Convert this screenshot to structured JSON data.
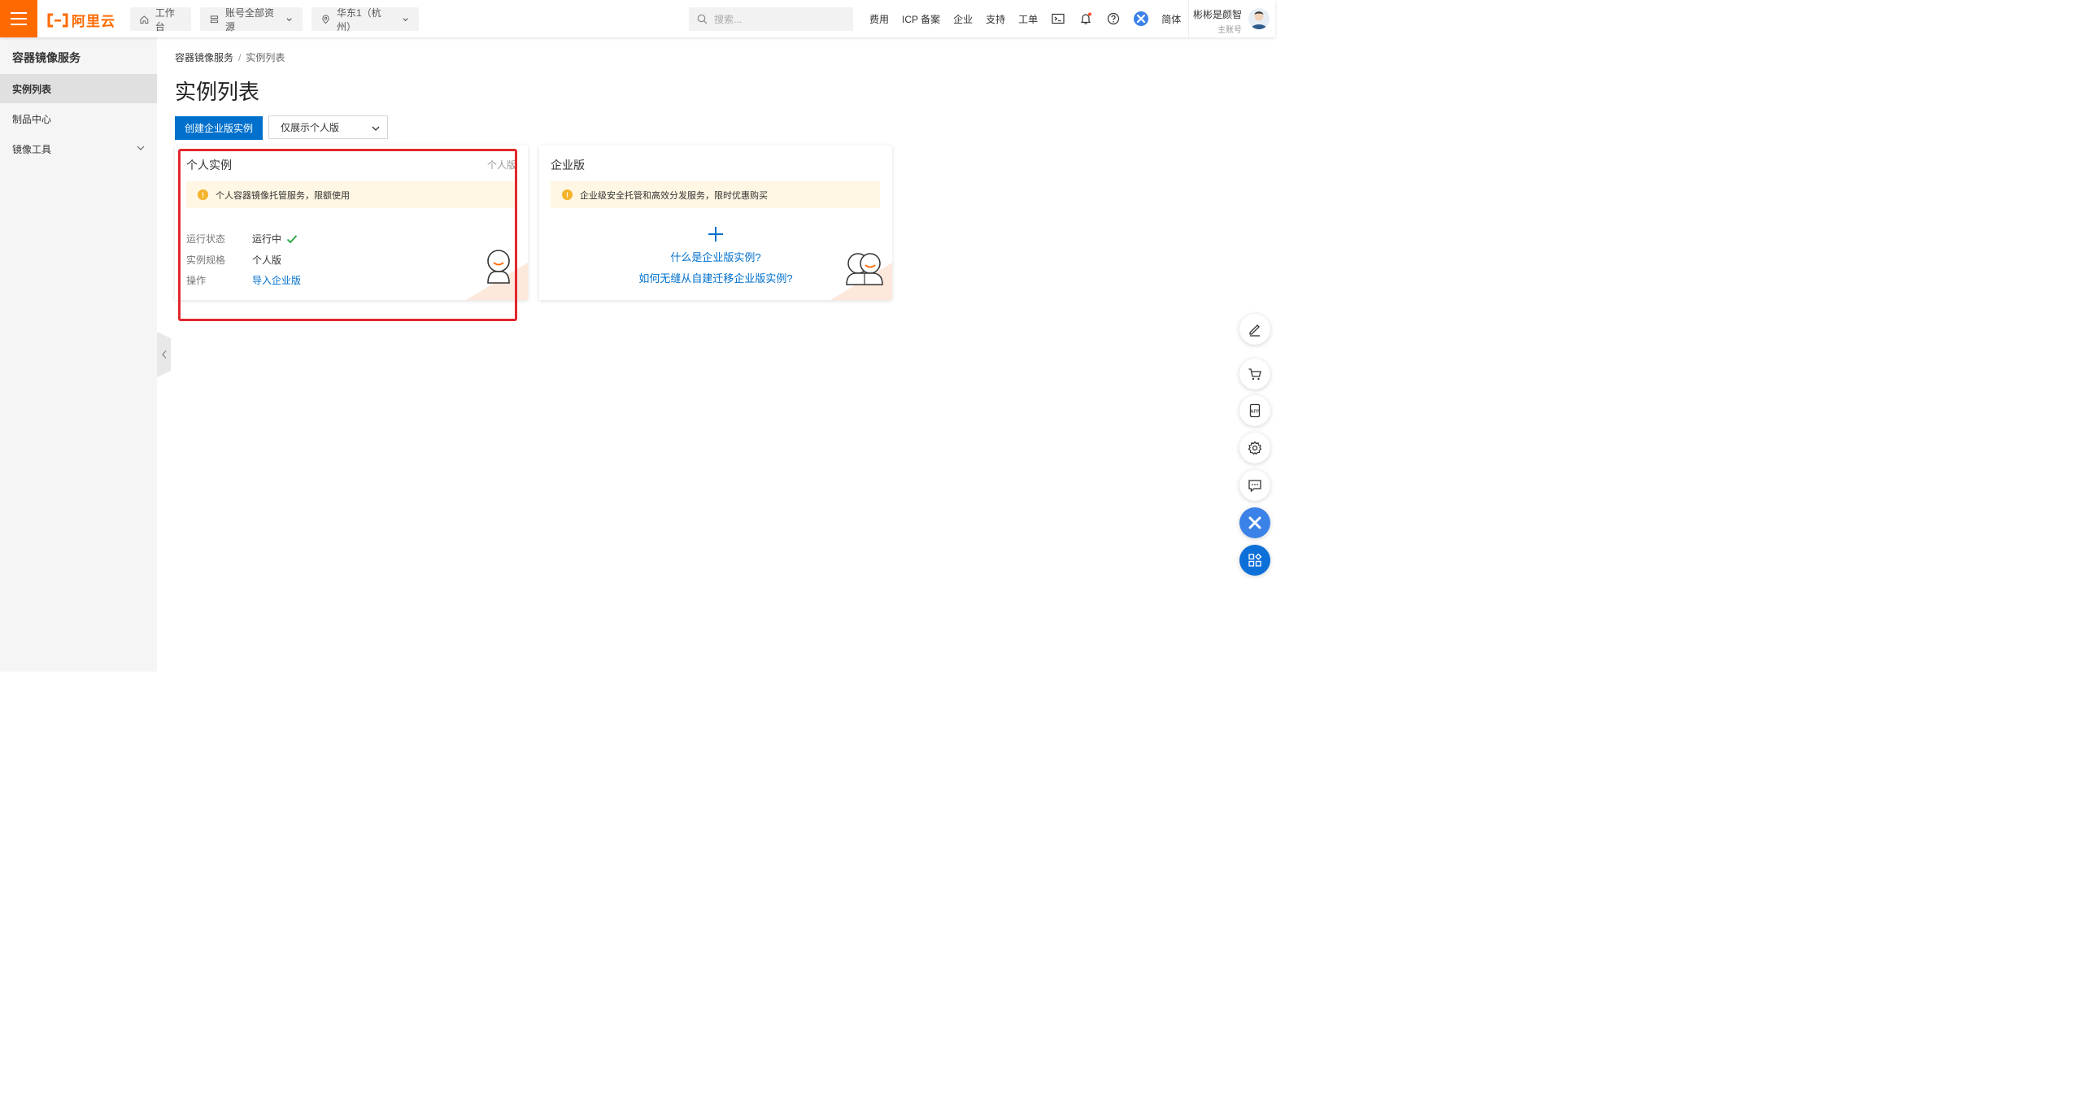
{
  "topbar": {
    "logo_text": "阿里云",
    "workbench": "工作台",
    "resources": "账号全部资源",
    "region": "华东1（杭州）",
    "search_placeholder": "搜索...",
    "links": [
      "费用",
      "ICP 备案",
      "企业",
      "支持",
      "工单"
    ],
    "language": "简体",
    "user_name": "彬彬是颜智",
    "user_sub": "主账号"
  },
  "sidebar": {
    "title": "容器镜像服务",
    "items": [
      {
        "label": "实例列表",
        "active": true
      },
      {
        "label": "制品中心",
        "active": false
      },
      {
        "label": "镜像工具",
        "active": false
      }
    ]
  },
  "breadcrumb": {
    "parent": "容器镜像服务",
    "separator": "/",
    "current": "实例列表"
  },
  "page": {
    "title": "实例列表",
    "create_button": "创建企业版实例",
    "filter_select": "仅展示个人版"
  },
  "personal_card": {
    "title": "个人实例",
    "tag": "个人版",
    "notice": "个人容器镜像托管服务，限额使用",
    "status_label": "运行状态",
    "status_value": "运行中",
    "spec_label": "实例规格",
    "spec_value": "个人版",
    "action_label": "操作",
    "action_link": "导入企业版"
  },
  "enterprise_card": {
    "title": "企业版",
    "notice": "企业级安全托管和高效分发服务，限时优惠购买",
    "link1": "什么是企业版实例?",
    "link2": "如何无缝从自建迁移企业版实例?"
  },
  "colors": {
    "brand": "#ff6a00",
    "primary": "#0070cc",
    "success": "#1fa33a",
    "warning": "#f5b32b",
    "highlight": "#e0282e"
  }
}
